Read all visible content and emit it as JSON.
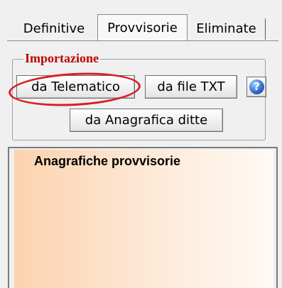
{
  "tabs": [
    {
      "label": "Definitive"
    },
    {
      "label": "Provvisorie",
      "selected": true
    },
    {
      "label": "Eliminate"
    }
  ],
  "import_group": {
    "legend": "Importazione",
    "buttons": {
      "telematico": "da Telematico",
      "txt": "da file TXT",
      "help": "?",
      "anagrafica": "da Anagrafica ditte"
    }
  },
  "list": {
    "title": "Anagrafiche provvisorie"
  },
  "colors": {
    "legend": "#c00000",
    "annotation": "#d81e2a",
    "list_gradient_start": "#fcd2ae",
    "list_gradient_end": "#fffaf5"
  }
}
